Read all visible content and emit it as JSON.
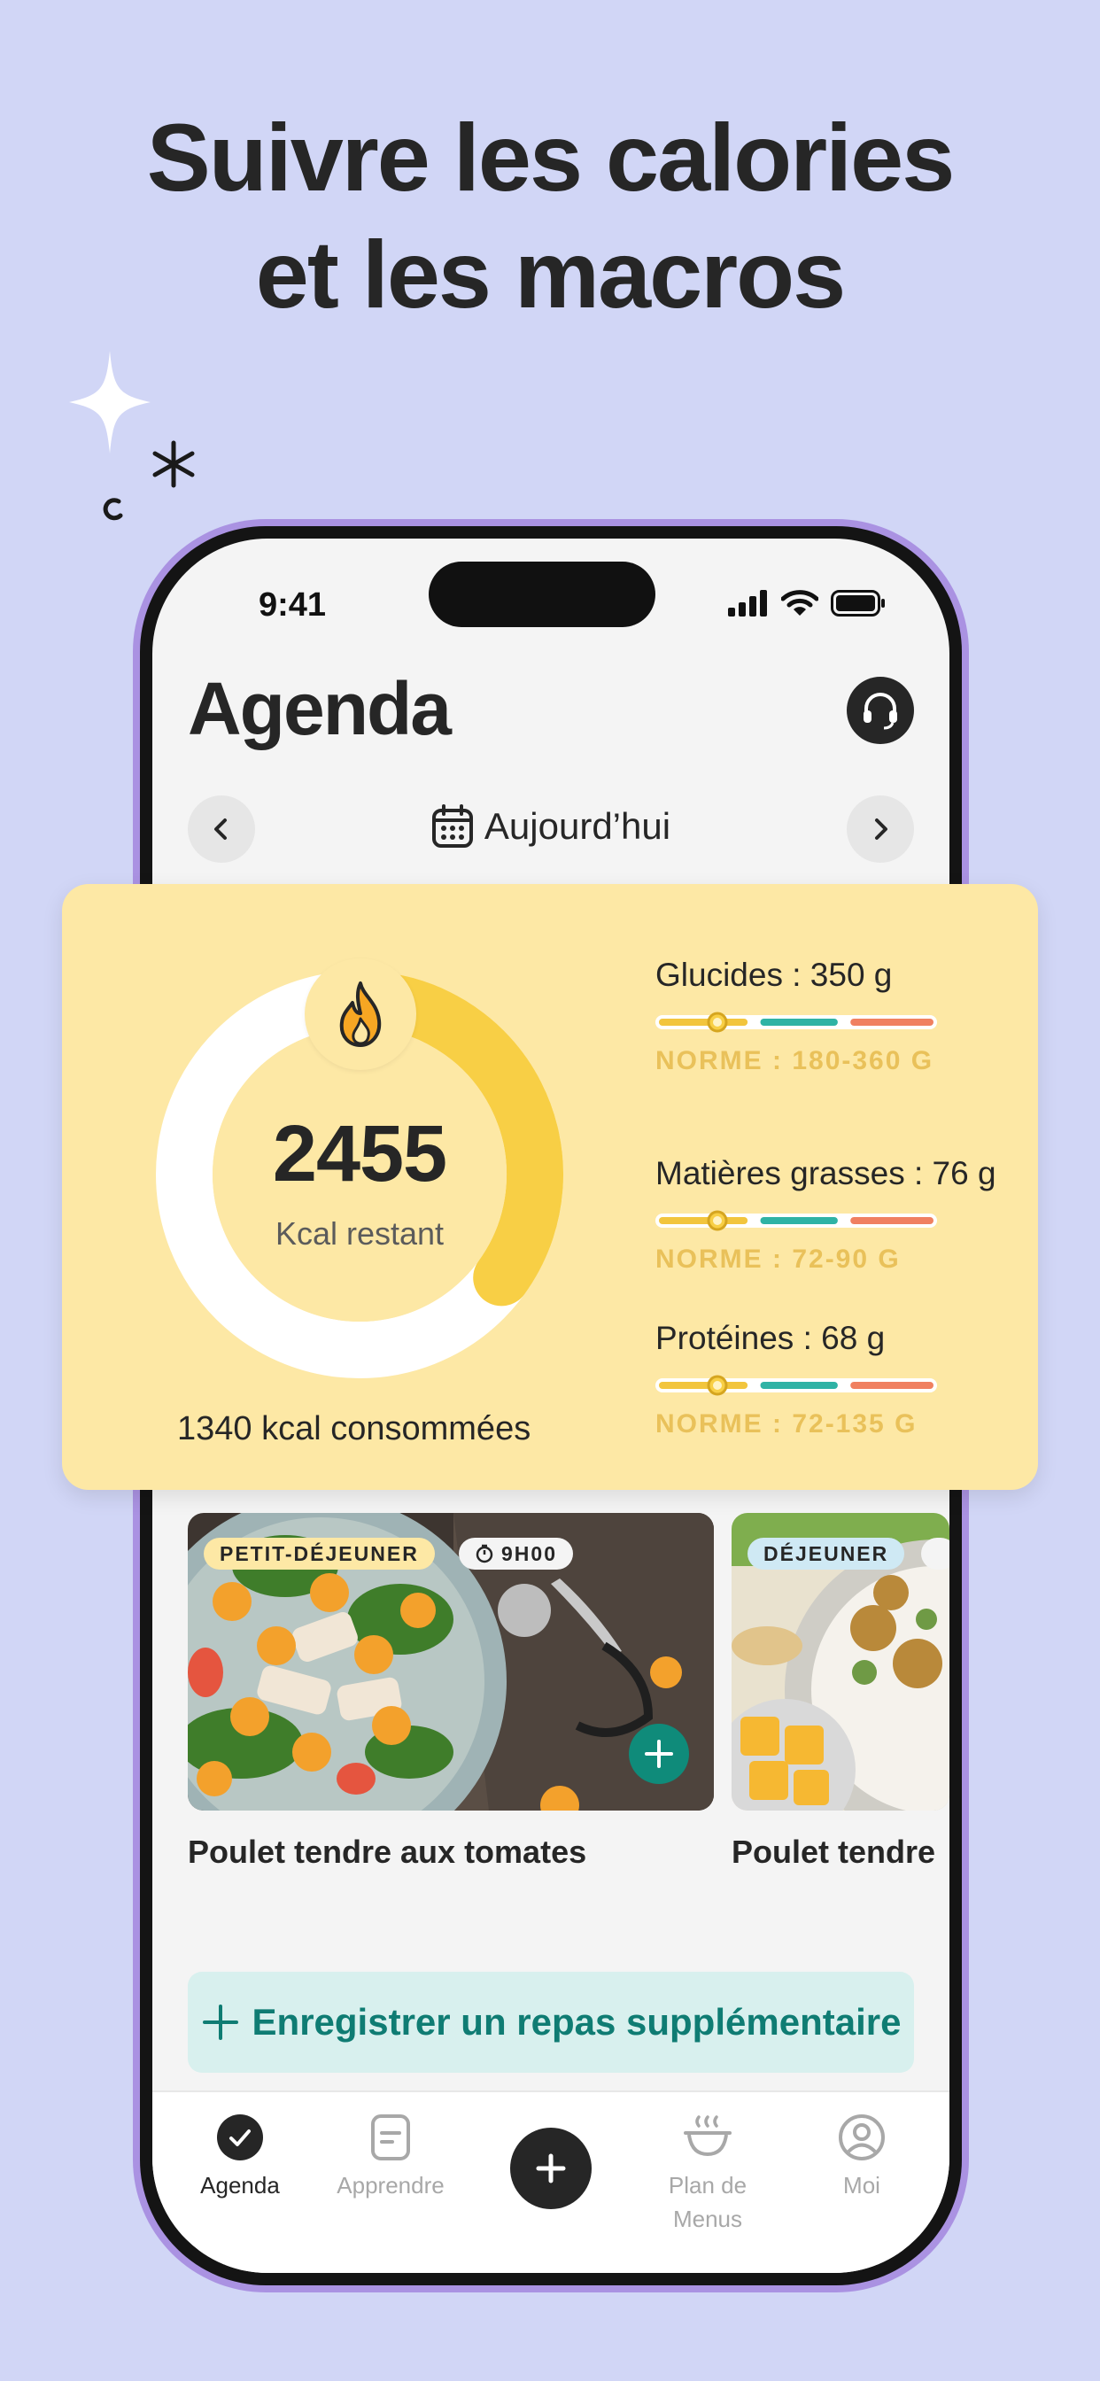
{
  "headline": [
    "Suivre les calories",
    "et les macros"
  ],
  "status_bar": {
    "time": "9:41"
  },
  "header": {
    "title": "Agenda",
    "support_icon": "headset-icon"
  },
  "date_nav": {
    "label": "Aujourd’hui",
    "prev_icon": "chevron-left-icon",
    "next_icon": "chevron-right-icon",
    "calendar_icon": "calendar-icon"
  },
  "summary": {
    "kcal_remaining": "2455",
    "kcal_remaining_label": "Kcal restant",
    "kcal_consumed": "1340 kcal consommées",
    "ring_progress": 0.35,
    "flame_icon": "flame-icon"
  },
  "macros": [
    {
      "label": "Glucides : 350 g",
      "norm": "NORME : 180-360 G",
      "level": 0.22
    },
    {
      "label": "Matières grasses : 76 g",
      "norm": "NORME : 72-90 G",
      "level": 0.22
    },
    {
      "label": "Protéines : 68 g",
      "norm": "NORME : 72-135 G",
      "level": 0.22
    }
  ],
  "meals": [
    {
      "tag": "PETIT-DÉJEUNER",
      "time": "9H00",
      "title": "Poulet tendre aux tomates"
    },
    {
      "tag": "DÉJEUNER",
      "title": "Poulet tendre"
    }
  ],
  "add_meal_label": "Enregistrer un repas supplémentaire",
  "tabs": [
    {
      "label": "Agenda",
      "icon": "check-circle-icon"
    },
    {
      "label": "Apprendre",
      "icon": "document-icon"
    },
    {
      "label": "",
      "icon": "plus-icon"
    },
    {
      "label": "Plan de Menus",
      "icon": "bowl-icon"
    },
    {
      "label": "Moi",
      "icon": "profile-icon"
    }
  ],
  "colors": {
    "background": "#d1d6f6",
    "card": "#fde8a5",
    "ring": "#f8cf45",
    "accent_teal": "#0f7c73",
    "bar_yellow": "#f2c53d",
    "bar_teal": "#2fb3a5",
    "bar_orange": "#f08060"
  }
}
